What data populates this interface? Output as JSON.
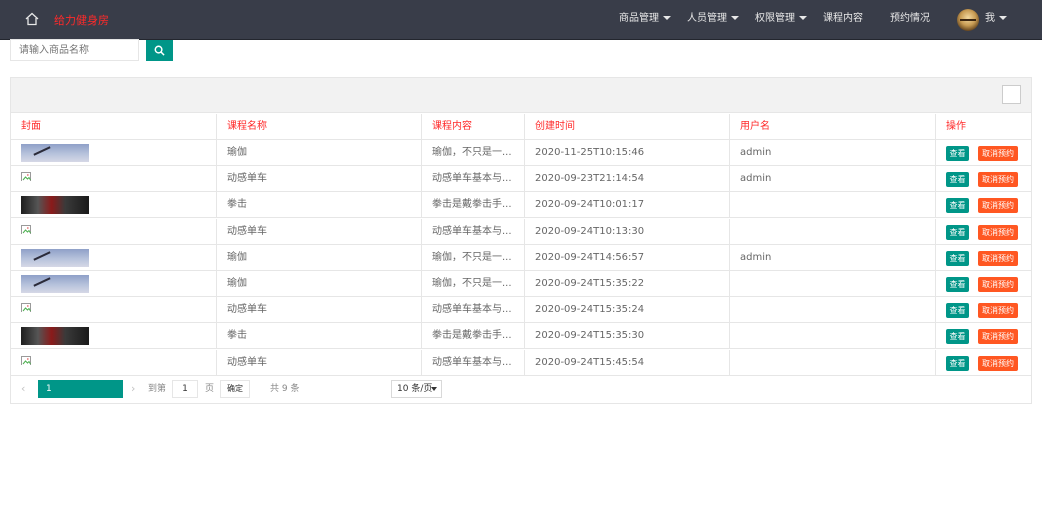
{
  "header": {
    "brand": "给力健身房",
    "nav": [
      {
        "label": "商品管理",
        "dropdown": true
      },
      {
        "label": "人员管理",
        "dropdown": true
      },
      {
        "label": "权限管理",
        "dropdown": true
      },
      {
        "label": "课程内容",
        "dropdown": false
      },
      {
        "label": "预约情况",
        "dropdown": false
      }
    ],
    "user_label": "我"
  },
  "search": {
    "placeholder": "请输入商品名称",
    "value": ""
  },
  "table": {
    "columns": [
      "封面",
      "课程名称",
      "课程内容",
      "创建时间",
      "用户名",
      "操作"
    ],
    "rows": [
      {
        "cover": "yoga",
        "name": "瑜伽",
        "content": "瑜伽，不只是一...",
        "created": "2020-11-25T10:15:46",
        "user": "admin"
      },
      {
        "cover": "broken",
        "name": "动感单车",
        "content": "动感单车基本与...",
        "created": "2020-09-23T21:14:54",
        "user": "admin"
      },
      {
        "cover": "boxing",
        "name": "拳击",
        "content": "拳击是戴拳击手...",
        "created": "2020-09-24T10:01:17",
        "user": ""
      },
      {
        "cover": "broken",
        "name": "动感单车",
        "content": "动感单车基本与...",
        "created": "2020-09-24T10:13:30",
        "user": ""
      },
      {
        "cover": "yoga",
        "name": "瑜伽",
        "content": "瑜伽，不只是一...",
        "created": "2020-09-24T14:56:57",
        "user": "admin"
      },
      {
        "cover": "yoga",
        "name": "瑜伽",
        "content": "瑜伽，不只是一...",
        "created": "2020-09-24T15:35:22",
        "user": ""
      },
      {
        "cover": "broken",
        "name": "动感单车",
        "content": "动感单车基本与...",
        "created": "2020-09-24T15:35:24",
        "user": ""
      },
      {
        "cover": "boxing",
        "name": "拳击",
        "content": "拳击是戴拳击手...",
        "created": "2020-09-24T15:35:30",
        "user": ""
      },
      {
        "cover": "broken",
        "name": "动感单车",
        "content": "动感单车基本与...",
        "created": "2020-09-24T15:45:54",
        "user": ""
      }
    ],
    "actions": {
      "view": "查看",
      "cancel": "取消预约"
    }
  },
  "pagination": {
    "current_page": "1",
    "goto_label": "到第",
    "goto_value": "1",
    "page_unit": "页",
    "confirm": "确定",
    "total": "共 9 条",
    "page_size": "10 条/页"
  },
  "colors": {
    "header_bg": "#393d49",
    "brand": "#ff2a2a",
    "accent": "#009688",
    "danger": "#ff5722",
    "column_header_text": "#ff2a2a"
  }
}
